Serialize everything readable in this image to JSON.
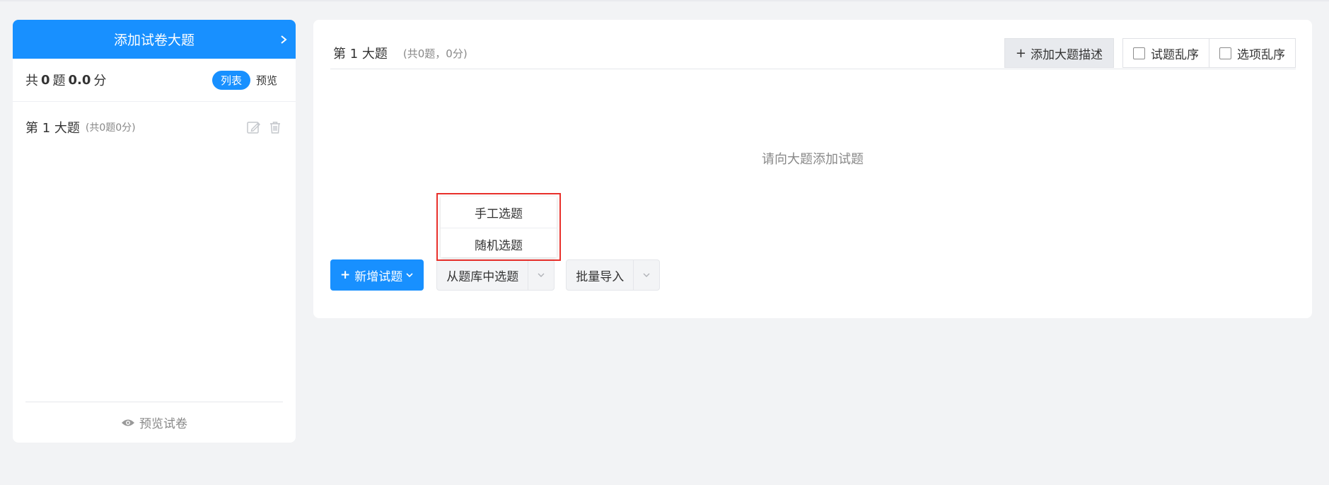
{
  "left_panel": {
    "header_title": "添加试卷大题",
    "summary": {
      "prefix": "共",
      "question_count": "0",
      "question_unit": "题",
      "score": "0.0",
      "score_unit": "分"
    },
    "view_toggle": {
      "active_label": "列表",
      "inactive_label": "预览"
    },
    "sections": [
      {
        "title": "第 1 大题",
        "count": "(共0题0分)"
      }
    ],
    "footer_label": "预览试卷"
  },
  "right_panel": {
    "section_title": "第 1 大题",
    "section_count": "(共0题，0分)",
    "add_desc_label": "添加大题描述",
    "shuffle_questions_label": "试题乱序",
    "shuffle_options_label": "选项乱序",
    "empty_hint": "请向大题添加试题",
    "add_question_label": "新增试题",
    "from_bank_label": "从题库中选题",
    "batch_import_label": "批量导入",
    "dropdown_items": [
      "手工选题",
      "随机选题"
    ]
  },
  "colors": {
    "primary": "#1890ff",
    "highlight_border": "#e8302b",
    "background": "#f2f3f5"
  },
  "icons": [
    "chevron-right-icon",
    "edit-icon",
    "trash-icon",
    "eye-icon",
    "chevron-down-icon",
    "plus-icon"
  ]
}
